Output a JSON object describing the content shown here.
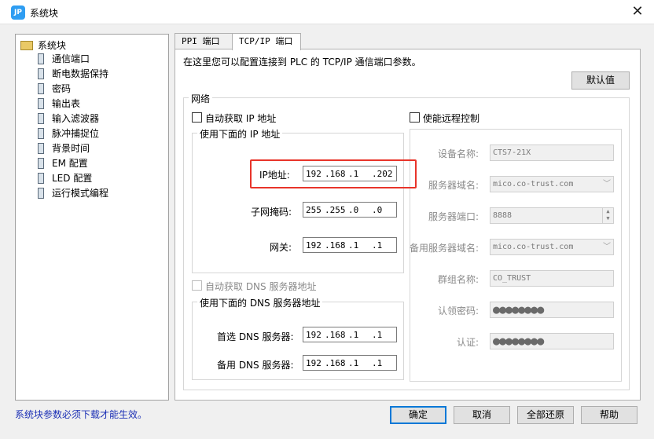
{
  "window": {
    "title": "系统块",
    "icon_text": "JP",
    "close_glyph": "✕"
  },
  "tree": {
    "root": "系统块",
    "items": [
      "通信端口",
      "断电数据保持",
      "密码",
      "输出表",
      "输入滤波器",
      "脉冲捕捉位",
      "背景时间",
      "EM 配置",
      "LED 配置",
      "运行模式编程"
    ]
  },
  "tabs": [
    "PPI 端口",
    "TCP/IP 端口"
  ],
  "panel": {
    "description": "在这里您可以配置连接到 PLC 的 TCP/IP 通信端口参数。",
    "default_button": "默认值",
    "network_group": "网络",
    "auto_ip_label": "自动获取 IP 地址",
    "use_ip_group": "使用下面的 IP 地址",
    "ip_label": "IP地址:",
    "ip_value": [
      "192",
      ".168",
      ".1",
      ".202"
    ],
    "subnet_label": "子网掩码:",
    "subnet_value": [
      "255",
      ".255",
      ".0",
      ".0"
    ],
    "gateway_label": "网关:",
    "gateway_value": [
      "192",
      ".168",
      ".1",
      ".1"
    ],
    "auto_dns_label": "自动获取 DNS 服务器地址",
    "use_dns_group": "使用下面的 DNS 服务器地址",
    "dns1_label": "首选 DNS 服务器:",
    "dns1_value": [
      "192",
      ".168",
      ".1",
      ".1"
    ],
    "dns2_label": "备用 DNS 服务器:",
    "dns2_value": [
      "192",
      ".168",
      ".1",
      ".1"
    ],
    "remote_label": "使能远程控制",
    "device_name_label": "设备名称:",
    "device_name_value": "CTS7-21X",
    "server_domain_label": "服务器域名:",
    "server_domain_value": "mico.co-trust.com",
    "server_port_label": "服务器端口:",
    "server_port_value": "8888",
    "backup_domain_label": "备用服务器域名:",
    "backup_domain_value": "mico.co-trust.com",
    "group_name_label": "群组名称:",
    "group_name_value": "CO_TRUST",
    "claim_pwd_label": "认领密码:",
    "claim_pwd_value": "●●●●●●●●",
    "confirm_label": "认证:",
    "confirm_value": "●●●●●●●●"
  },
  "footer": {
    "note": "系统块参数必须下载才能生效。",
    "ok": "确定",
    "cancel": "取消",
    "restore_all": "全部还原",
    "help": "帮助"
  }
}
